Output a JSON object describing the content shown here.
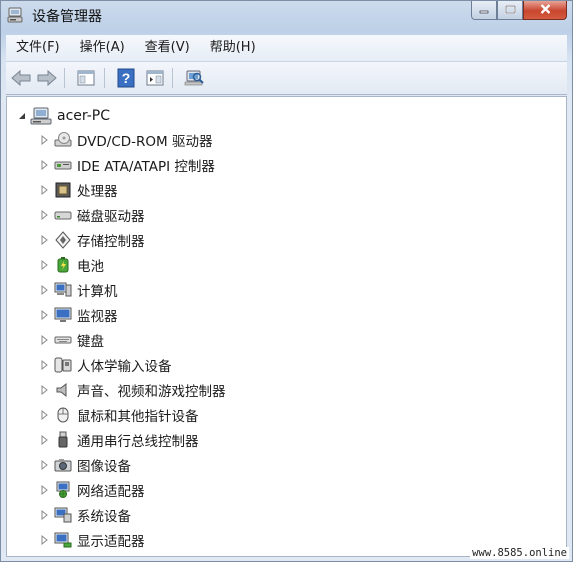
{
  "window": {
    "title": "设备管理器",
    "buttons": {
      "minimize": "▁",
      "maximize": "▢",
      "close": "✕"
    }
  },
  "menubar": {
    "items": [
      "文件(F)",
      "操作(A)",
      "查看(V)",
      "帮助(H)"
    ]
  },
  "toolbar": {
    "icons": [
      "back-arrow-icon",
      "forward-arrow-icon",
      "show-hide-console-tree-icon",
      "help-icon",
      "properties-icon",
      "scan-hardware-icon"
    ]
  },
  "tree": {
    "root": {
      "label": "acer-PC",
      "icon": "computer-icon"
    },
    "items": [
      {
        "label": "DVD/CD-ROM 驱动器",
        "icon": "dvd-drive-icon"
      },
      {
        "label": "IDE ATA/ATAPI 控制器",
        "icon": "ide-controller-icon"
      },
      {
        "label": "处理器",
        "icon": "processor-icon"
      },
      {
        "label": "磁盘驱动器",
        "icon": "disk-drive-icon"
      },
      {
        "label": "存储控制器",
        "icon": "storage-controller-icon"
      },
      {
        "label": "电池",
        "icon": "battery-icon"
      },
      {
        "label": "计算机",
        "icon": "computer-icon"
      },
      {
        "label": "监视器",
        "icon": "monitor-icon"
      },
      {
        "label": "键盘",
        "icon": "keyboard-icon"
      },
      {
        "label": "人体学输入设备",
        "icon": "hid-icon"
      },
      {
        "label": "声音、视频和游戏控制器",
        "icon": "speaker-icon"
      },
      {
        "label": "鼠标和其他指针设备",
        "icon": "mouse-icon"
      },
      {
        "label": "通用串行总线控制器",
        "icon": "usb-icon"
      },
      {
        "label": "图像设备",
        "icon": "camera-icon"
      },
      {
        "label": "网络适配器",
        "icon": "network-adapter-icon"
      },
      {
        "label": "系统设备",
        "icon": "system-device-icon"
      },
      {
        "label": "显示适配器",
        "icon": "display-adapter-icon"
      }
    ]
  },
  "watermark": "www.8585.online"
}
